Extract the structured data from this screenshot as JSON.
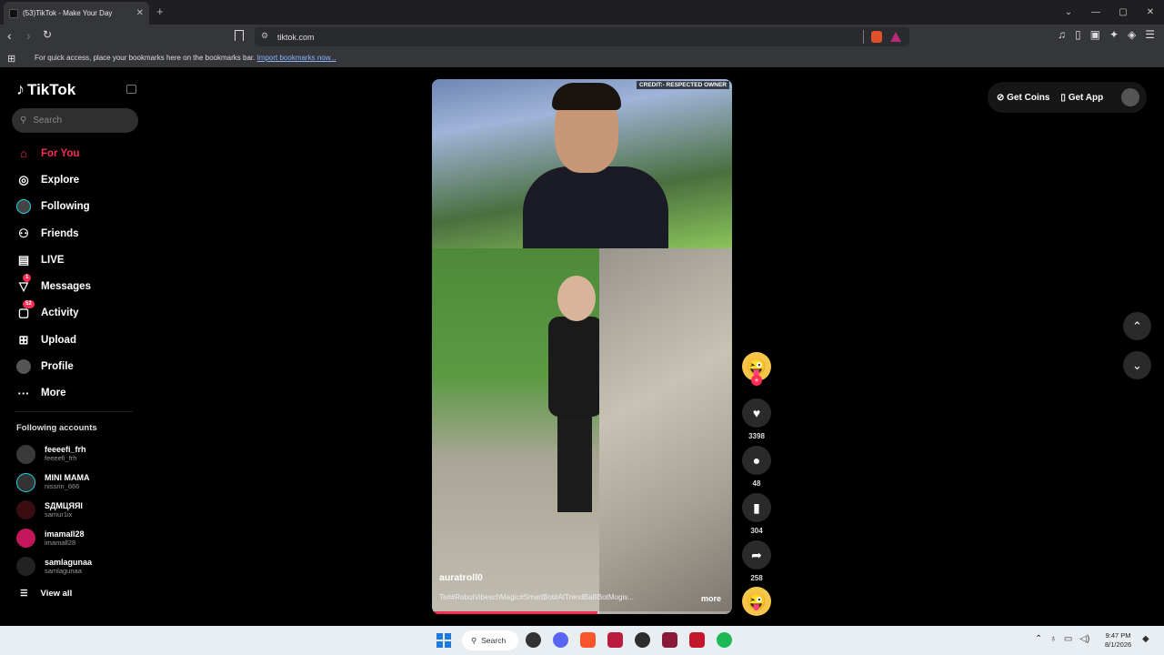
{
  "browser": {
    "tab_title": "(53)TikTok - Make Your Day",
    "url": "tiktok.com",
    "bookmarks_hint": "For quick access, place your bookmarks here on the bookmarks bar.",
    "import_link": "Import bookmarks now..."
  },
  "sidebar": {
    "logo": "TikTok",
    "search_placeholder": "Search",
    "nav": [
      {
        "label": "For You",
        "icon": "home-icon",
        "active": true
      },
      {
        "label": "Explore",
        "icon": "compass-icon"
      },
      {
        "label": "Following",
        "icon": "following-avatar-icon"
      },
      {
        "label": "Friends",
        "icon": "friends-icon"
      },
      {
        "label": "LIVE",
        "icon": "live-icon"
      },
      {
        "label": "Messages",
        "icon": "messages-icon",
        "badge": "1"
      },
      {
        "label": "Activity",
        "icon": "activity-icon",
        "badge": "52"
      },
      {
        "label": "Upload",
        "icon": "upload-icon"
      },
      {
        "label": "Profile",
        "icon": "profile-avatar-icon"
      },
      {
        "label": "More",
        "icon": "more-icon"
      }
    ],
    "following_title": "Following accounts",
    "accounts": [
      {
        "name": "feeeefi_frh",
        "handle": "feeeefi_frh"
      },
      {
        "name": "MINI MAMA",
        "handle": "nissrin_666"
      },
      {
        "name": "ЅДМЦЯЯI",
        "handle": "samur1ix"
      },
      {
        "name": "imamall28",
        "handle": "imamall28"
      },
      {
        "name": "samlagunaa",
        "handle": "samlagunaa"
      }
    ],
    "view_all": "View all"
  },
  "video": {
    "credit": "CREDIT:- RESPECTED OWNER",
    "username": "auratroll0",
    "caption": "Te##RobotVibeschMagic#SmartBot#AITrendBalliBotMogis...",
    "more": "more",
    "progress": 0.55
  },
  "actions": {
    "likes": "3398",
    "comments": "48",
    "saves": "304",
    "shares": "258"
  },
  "topright": {
    "coins": "Get Coins",
    "app": "Get App"
  },
  "taskbar": {
    "search": "Search",
    "time": "9:47 PM",
    "date": "8/1/2026"
  }
}
